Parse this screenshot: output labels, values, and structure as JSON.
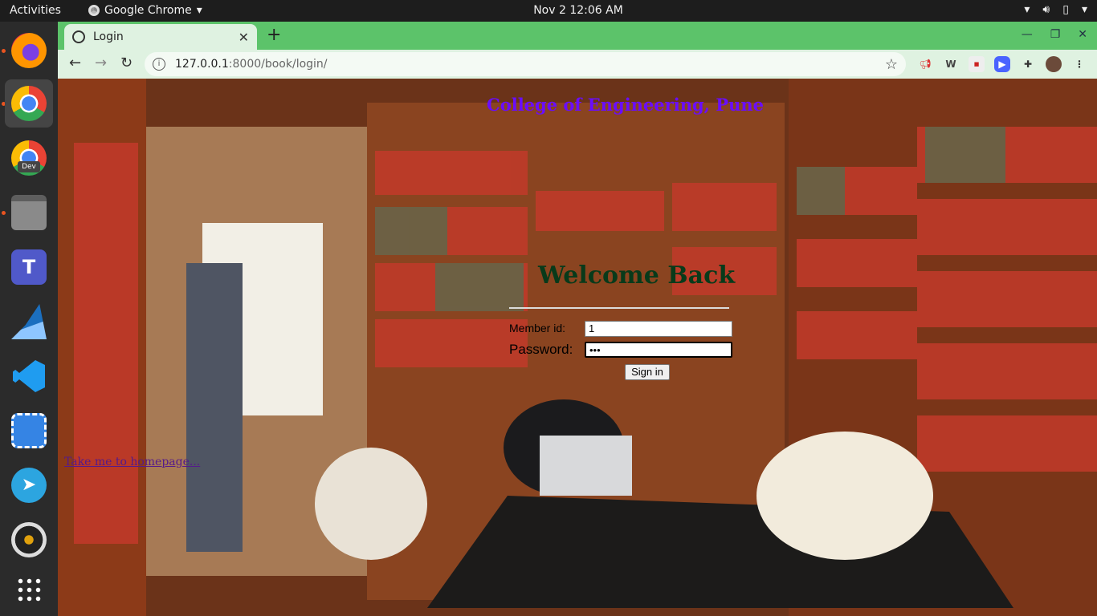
{
  "topbar": {
    "activities": "Activities",
    "app_name": "Google Chrome",
    "clock": "Nov 2  12:06 AM"
  },
  "dock": {
    "apps": [
      "firefox-icon",
      "chrome-icon",
      "chrome-dev-icon",
      "files-icon",
      "teams-icon",
      "wireshark-icon",
      "vscode-icon",
      "screenshot-icon",
      "telegram-icon",
      "rhythmbox-icon",
      "app-grid-icon"
    ],
    "dev_badge": "Dev"
  },
  "browser": {
    "tab_title": "Login",
    "url_host": "127.0.0.1",
    "url_rest": ":8000/book/login/",
    "accent": "#5cc36a"
  },
  "page": {
    "college_title": "College of Engineering, Pune",
    "welcome": "Welcome Back",
    "member_label": "Member id:",
    "member_value": "1",
    "password_label": "Password:",
    "password_value": "•••",
    "sign_in": "Sign in",
    "home_link": "Take me to homepage...",
    "title_color": "#6a0dfc",
    "welcome_color": "#083a1a"
  }
}
